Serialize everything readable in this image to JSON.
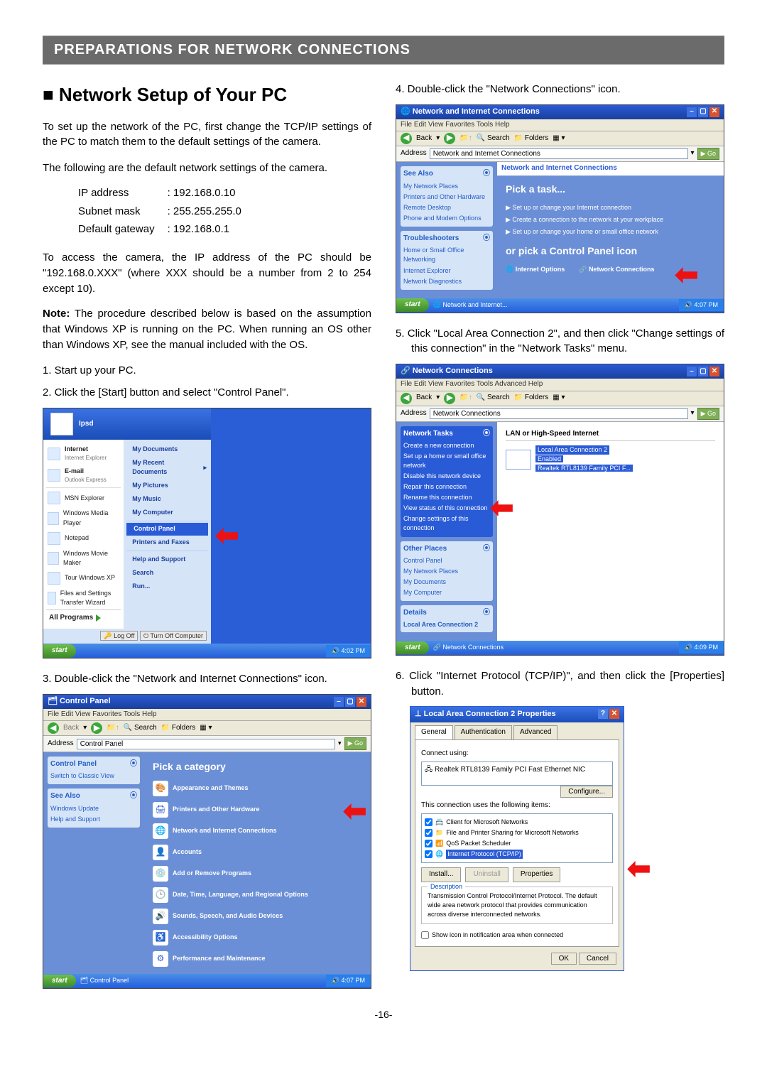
{
  "header": "PREPARATIONS FOR NETWORK CONNECTIONS",
  "section_title": "■ Network Setup of Your PC",
  "intro1": "To set up the network of the PC, first change the TCP/IP settings of the PC to match them to the default settings of the camera.",
  "intro2": "The following are the default network settings of the camera.",
  "params": {
    "ip_label": "IP address",
    "ip_val": ": 192.168.0.10",
    "mask_label": "Subnet mask",
    "mask_val": ": 255.255.255.0",
    "gw_label": "Default gateway",
    "gw_val": ": 192.168.0.1"
  },
  "intro3": "To access the camera, the IP address of the PC should be \"192.168.0.XXX\" (where XXX should be a number from 2 to 254 except 10).",
  "note_label": "Note:",
  "note_text": " The procedure described below is based on the assumption that Windows XP is running on the PC. When running an OS other than Windows XP, see the manual included with the OS.",
  "steps": {
    "s1": "1. Start up your PC.",
    "s2": "2. Click the [Start] button and select \"Control Panel\".",
    "s3": "3. Double-click the \"Network and Internet Connections\" icon.",
    "s4": "4. Double-click the \"Network Connections\" icon.",
    "s5": "5. Click \"Local Area Connection 2\", and then click \"Change settings of this connection\" in the \"Network Tasks\" menu.",
    "s6": "6. Click \"Internet Protocol (TCP/IP)\", and then click the [Properties] button."
  },
  "page_num": "-16-",
  "startmenu": {
    "user": "Ipsd",
    "left": [
      "Internet",
      "E-mail",
      "MSN Explorer",
      "Windows Media Player",
      "Notepad",
      "Windows Movie Maker",
      "Tour Windows XP",
      "Files and Settings Transfer Wizard"
    ],
    "internet_sub": "Internet Explorer",
    "email_sub": "Outlook Express",
    "right": [
      "My Documents",
      "My Recent Documents",
      "My Pictures",
      "My Music",
      "My Computer",
      "Control Panel",
      "Printers and Faxes",
      "Help and Support",
      "Search",
      "Run..."
    ],
    "all_programs": "All Programs",
    "logoff": "Log Off",
    "turnoff": "Turn Off Computer",
    "start": "start",
    "tray_time": "4:02 PM"
  },
  "cp1": {
    "title": "Control Panel",
    "menu": "File  Edit  View  Favorites  Tools  Help",
    "back": "Back",
    "search": "Search",
    "folders": "Folders",
    "address": "Address",
    "addr_val": "Control Panel",
    "go": "Go",
    "side_hdr1": "Control Panel",
    "side_a1": "Switch to Classic View",
    "side_hdr2": "See Also",
    "side_a2": "Windows Update",
    "side_a3": "Help and Support",
    "heading": "Pick a category",
    "items": [
      "Appearance and Themes",
      "Printers and Other Hardware",
      "Network and Internet Connections",
      "Accounts",
      "Add or Remove Programs",
      "Date, Time, Language, and Regional Options",
      "Sounds, Speech, and Audio Devices",
      "Accessibility Options",
      "Performance and Maintenance"
    ],
    "taskbar_task": "Control Panel",
    "tray_time": "4:07 PM"
  },
  "cp2": {
    "title": "Network and Internet Connections",
    "menu": "File  Edit  View  Favorites  Tools  Help",
    "addr_val": "Network and Internet Connections",
    "side_hdr1": "See Also",
    "side_a": [
      "My Network Places",
      "Printers and Other Hardware",
      "Remote Desktop",
      "Phone and Modem Options"
    ],
    "side_hdr2": "Troubleshooters",
    "side_b": [
      "Home or Small Office Networking",
      "Internet Explorer",
      "Network Diagnostics"
    ],
    "heading_small": "Network and Internet Connections",
    "pick_task": "Pick a task...",
    "t1": "Set up or change your Internet connection",
    "t2": "Create a connection to the network at your workplace",
    "t3": "Set up or change your home or small office network",
    "pick_icon": "or pick a Control Panel icon",
    "i1": "Internet Options",
    "i2": "Network Connections",
    "taskbar_task": "Network and Internet...",
    "tray_time": "4:07 PM"
  },
  "nc": {
    "title": "Network Connections",
    "menu": "File  Edit  View  Favorites  Tools  Advanced  Help",
    "addr_val": "Network Connections",
    "side_hdr1": "Network Tasks",
    "side_a": [
      "Create a new connection",
      "Set up a home or small office network",
      "Disable this network device",
      "Repair this connection",
      "Rename this connection",
      "View status of this connection",
      "Change settings of this connection"
    ],
    "side_hdr2": "Other Places",
    "side_b": [
      "Control Panel",
      "My Network Places",
      "My Documents",
      "My Computer"
    ],
    "side_hdr3": "Details",
    "details_txt": "Local Area Connection 2",
    "group_hdr": "LAN or High-Speed Internet",
    "lan_title": "Local Area Connection 2",
    "lan_sub1": "Enabled",
    "lan_sub2": "Realtek RTL8139 Family PCI F...",
    "taskbar_task": "Network Connections",
    "tray_time": "4:09 PM"
  },
  "dlg": {
    "title": "Local Area Connection 2 Properties",
    "tabs": [
      "General",
      "Authentication",
      "Advanced"
    ],
    "connect_using": "Connect using:",
    "nic": "Realtek RTL8139 Family PCI Fast Ethernet NIC",
    "configure": "Configure...",
    "uses_items": "This connection uses the following items:",
    "items": [
      "Client for Microsoft Networks",
      "File and Printer Sharing for Microsoft Networks",
      "QoS Packet Scheduler",
      "Internet Protocol (TCP/IP)"
    ],
    "install": "Install...",
    "uninstall": "Uninstall",
    "properties": "Properties",
    "desc_label": "Description",
    "desc": "Transmission Control Protocol/Internet Protocol. The default wide area network protocol that provides communication across diverse interconnected networks.",
    "show_icon": "Show icon in notification area when connected",
    "ok": "OK",
    "cancel": "Cancel"
  }
}
